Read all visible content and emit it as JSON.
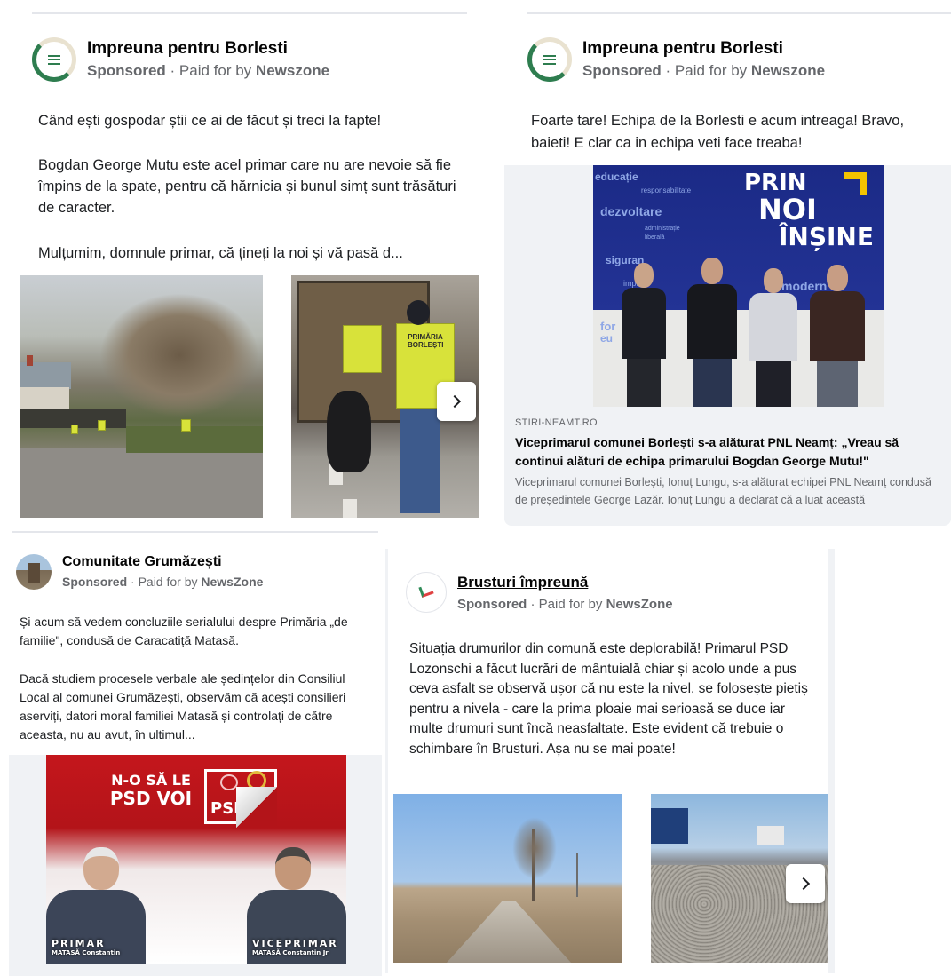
{
  "ad1": {
    "page_name": "Impreuna pentru Borlesti",
    "sponsored": "Sponsored",
    "paid_for": "· Paid for by",
    "sponsor": "Newszone",
    "text_p1": "Când ești gospodar știi ce ai de făcut și treci la fapte!",
    "text_p2": "Bogdan George Mutu este acel primar care nu are nevoie să fie împins de la spate, pentru că hărnicia și bunul simț sunt trăsături de caracter.",
    "text_p3": "Mulțumim, domnule primar, că țineți la noi și vă pasă d...",
    "vest_text": "PRIMĂRIA BORLEȘTI",
    "next_icon": "chevron-right-icon"
  },
  "ad2": {
    "page_name": "Impreuna pentru Borlesti",
    "sponsored": "Sponsored",
    "paid_for": "· Paid for by",
    "sponsor": "Newszone",
    "text": "Foarte tare! Echipa de la Borlesti e acum intreaga! Bravo, baieti! E clar ca in echipa veti face treaba!",
    "banner_line1": "PRIN",
    "banner_line2": "NOI",
    "banner_line3": "ÎNȘINE",
    "banner_words": [
      "educație",
      "responsabilitate",
      "dezvoltare",
      "administrație",
      "liberală",
      "siguran",
      "impl",
      "modern",
      "for",
      "eu"
    ],
    "link_domain": "STIRI-NEAMT.RO",
    "link_title": "Viceprimarul comunei Borlești s-a alăturat PNL Neamț: „Vreau să continui alături de echipa primarului Bogdan George Mutu!\"",
    "link_desc": "Viceprimarul comunei Borlești, Ionuț Lungu, s-a alăturat echipei PNL Neamț condusă de președintele George Lazăr. Ionuț Lungu a declarat că a luat această"
  },
  "ad3": {
    "page_name": "Comunitate Grumăzești",
    "sponsored": "Sponsored",
    "paid_for": "· Paid for by",
    "sponsor": "NewsZone",
    "text_p1": "Și acum să vedem concluziile serialului despre Primăria „de familie\", condusă de Caracatiță Matasă.",
    "text_p2": "Dacă studiem procesele verbale ale ședințelor din Consiliul Local al comunei Grumăzești, observăm că acești consilieri aserviți, datori moral familiei Matasă și controlați de către aceasta, nu au avut, în ultimul...",
    "poster_line1": "N-O SĂ LE",
    "poster_line2": "PSD VOI",
    "poster_logo": "PSD",
    "label_left": "PRIMAR",
    "name_left": "MATASĂ Constantin",
    "label_right": "VICEPRIMAR",
    "name_right": "MATASĂ Constantin Jr"
  },
  "ad4": {
    "page_name": "Brusturi împreună",
    "sponsored": "Sponsored",
    "paid_for": "· Paid for by",
    "sponsor": "NewsZone",
    "text": "Situația drumurilor din comună este deplorabilă! Primarul PSD Lozonschi a făcut lucrări de mântuială chiar și acolo unde a pus ceva asfalt se observă ușor că nu este la nivel, se folosește pietiș pentru a nivela - care la prima ploaie mai serioasă se duce iar multe drumuri sunt încă neasfaltate. Este evident că trebuie o schimbare în Brusturi. Așa nu se mai poate!",
    "next_icon": "chevron-right-icon"
  },
  "colors": {
    "sponsor_gray": "#65676b",
    "psd_red": "#c4161c",
    "banner_blue": "#1e2d8c",
    "vest_yellow": "#d8e23a",
    "logo_green": "#2e7d4f"
  }
}
